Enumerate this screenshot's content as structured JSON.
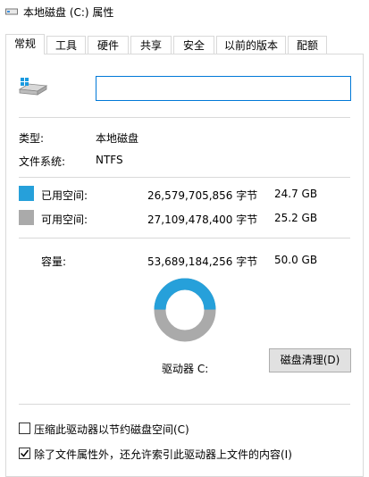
{
  "window": {
    "title": "本地磁盘 (C:) 属性"
  },
  "tabs": [
    {
      "label": "常规",
      "active": true
    },
    {
      "label": "工具",
      "active": false
    },
    {
      "label": "硬件",
      "active": false
    },
    {
      "label": "共享",
      "active": false
    },
    {
      "label": "安全",
      "active": false
    },
    {
      "label": "以前的版本",
      "active": false
    },
    {
      "label": "配额",
      "active": false
    }
  ],
  "drive": {
    "name_value": ""
  },
  "type": {
    "label": "类型:",
    "value": "本地磁盘"
  },
  "filesystem": {
    "label": "文件系统:",
    "value": "NTFS"
  },
  "used": {
    "label": "已用空间:",
    "bytes": "26,579,705,856 字节",
    "size": "24.7 GB",
    "color": "#26a0da"
  },
  "free": {
    "label": "可用空间:",
    "bytes": "27,109,478,400 字节",
    "size": "25.2 GB",
    "color": "#aaaaaa"
  },
  "capacity": {
    "label": "容量:",
    "bytes": "53,689,184,256 字节",
    "size": "50.0 GB"
  },
  "usage": {
    "used_fraction": 0.495
  },
  "drive_label": "驱动器 C:",
  "cleanup_button": "磁盘清理(D)",
  "options": {
    "compress": {
      "label": "压缩此驱动器以节约磁盘空间(C)",
      "checked": false
    },
    "index": {
      "label": "除了文件属性外，还允许索引此驱动器上文件的内容(I)",
      "checked": true
    }
  }
}
